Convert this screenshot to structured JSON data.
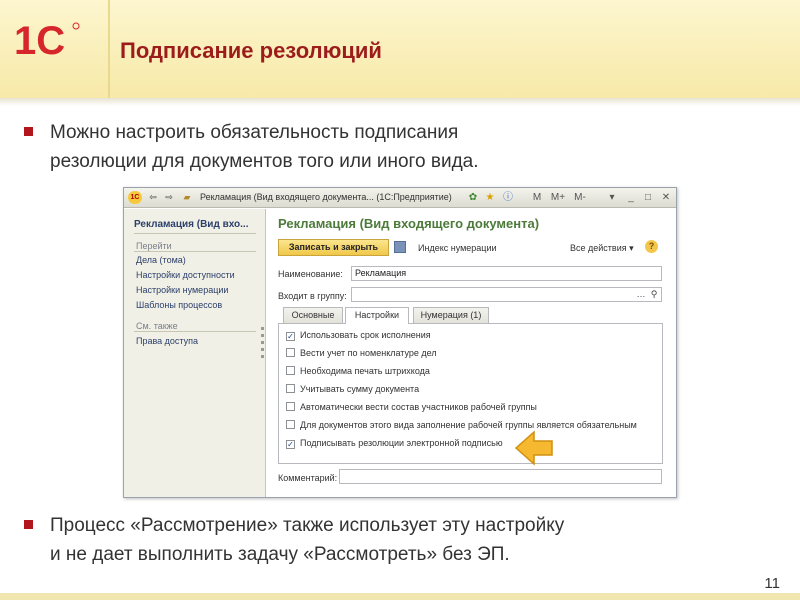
{
  "slide": {
    "logo_text": "1С",
    "title": "Подписание резолюций",
    "bullet1_line1": "Можно настроить обязательность подписания",
    "bullet1_line2": "резолюции для документов того или иного вида.",
    "bullet2_line1": "Процесс «Рассмотрение» также использует эту настройку",
    "bullet2_line2": "и не дает выполнить задачу «Рассмотреть» без ЭП.",
    "page_number": "11",
    "accent_color": "#b2151b",
    "title_color": "#9c1c1c"
  },
  "window": {
    "title": "Рекламация (Вид входящего документа... (1С:Предприятие)",
    "title_buttons": [
      "M",
      "M+",
      "M-",
      "▾",
      "_",
      "□",
      "✕"
    ],
    "left_panel": {
      "title": "Рекламация (Вид вхо...",
      "goto_heading": "Перейти",
      "goto_links": [
        "Дела (тома)",
        "Настройки доступности",
        "Настройки нумерации",
        "Шаблоны процессов"
      ],
      "see_also_heading": "См. также",
      "see_also_links": [
        "Права доступа"
      ]
    },
    "form": {
      "title": "Рекламация (Вид входящего документа)",
      "save_close_label": "Записать и закрыть",
      "numbering_index_label": "Индекс нумерации",
      "all_actions_label": "Все действия ▾",
      "name_label": "Наименование:",
      "name_value": "Рекламация",
      "group_label": "Входит в группу:",
      "group_value": "",
      "tabs": [
        {
          "label": "Основные",
          "active": false
        },
        {
          "label": "Настройки",
          "active": true
        },
        {
          "label": "Нумерация (1)",
          "active": false
        }
      ],
      "options": [
        {
          "label": "Использовать срок исполнения",
          "checked": true
        },
        {
          "label": "Вести учет по номенклатуре дел",
          "checked": false
        },
        {
          "label": "Необходима печать штрихкода",
          "checked": false
        },
        {
          "label": "Учитывать сумму документа",
          "checked": false
        },
        {
          "label": "Автоматически вести состав участников рабочей группы",
          "checked": false
        },
        {
          "label": "Для документов этого вида заполнение рабочей группы является обязательным",
          "checked": false
        },
        {
          "label": "Подписывать резолюции электронной подписью",
          "checked": true
        }
      ],
      "comment_label": "Комментарий:",
      "comment_value": ""
    }
  }
}
